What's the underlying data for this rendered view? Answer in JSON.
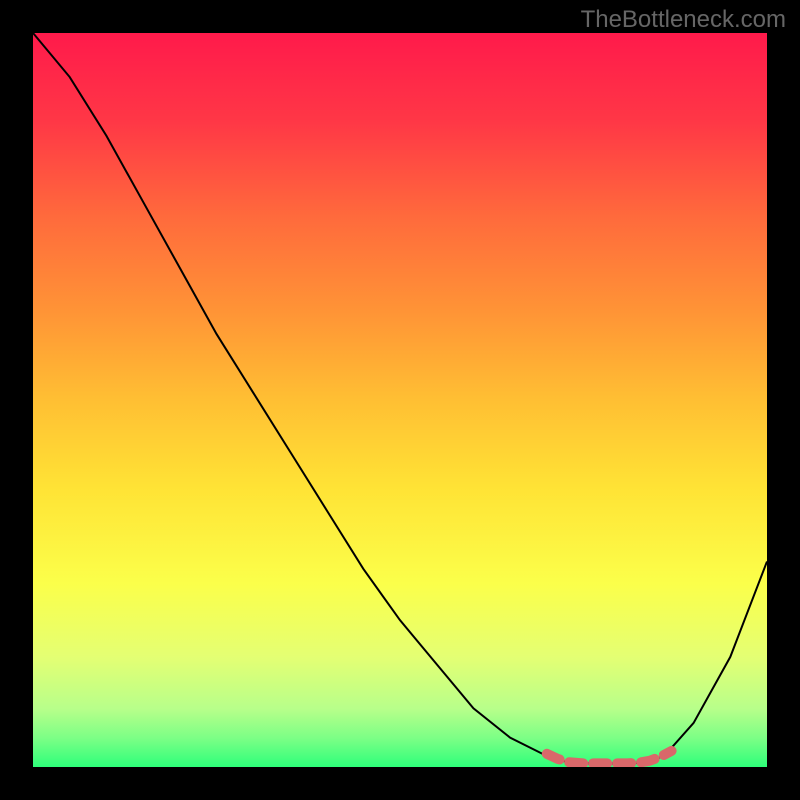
{
  "watermark": "TheBottleneck.com",
  "chart_data": {
    "type": "line",
    "title": "",
    "xlabel": "",
    "ylabel": "",
    "xlim": [
      0,
      100
    ],
    "ylim": [
      0,
      100
    ],
    "series": [
      {
        "name": "main-curve",
        "color": "#000000",
        "x": [
          0,
          5,
          10,
          15,
          20,
          25,
          30,
          35,
          40,
          45,
          50,
          55,
          60,
          65,
          70,
          73,
          76,
          80,
          83,
          86,
          90,
          95,
          100
        ],
        "y": [
          100,
          94,
          86,
          77,
          68,
          59,
          51,
          43,
          35,
          27,
          20,
          14,
          8,
          4,
          1.5,
          0.6,
          0.5,
          0.5,
          0.6,
          1.5,
          6,
          15,
          28
        ]
      },
      {
        "name": "highlight-segment",
        "color": "#d9686a",
        "x": [
          70,
          71.5,
          73,
          75,
          77,
          79,
          81,
          82.5,
          84,
          85.5,
          87
        ],
        "y": [
          1.8,
          1.1,
          0.65,
          0.5,
          0.5,
          0.5,
          0.5,
          0.58,
          0.85,
          1.4,
          2.2
        ]
      }
    ],
    "background_gradient": {
      "stops": [
        {
          "offset": 0,
          "color": "#ff1a4b"
        },
        {
          "offset": 12,
          "color": "#ff3746"
        },
        {
          "offset": 25,
          "color": "#ff6a3c"
        },
        {
          "offset": 38,
          "color": "#ff9436"
        },
        {
          "offset": 50,
          "color": "#ffbf33"
        },
        {
          "offset": 62,
          "color": "#ffe335"
        },
        {
          "offset": 75,
          "color": "#fbff4a"
        },
        {
          "offset": 85,
          "color": "#e4ff73"
        },
        {
          "offset": 92,
          "color": "#b8ff8a"
        },
        {
          "offset": 96,
          "color": "#7dff86"
        },
        {
          "offset": 100,
          "color": "#2eff7a"
        }
      ]
    }
  }
}
